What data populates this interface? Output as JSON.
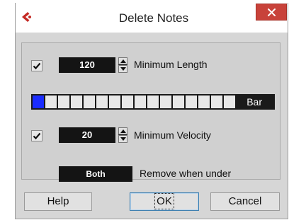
{
  "window": {
    "title": "Delete Notes",
    "app_icon": "cubase-logo-icon",
    "close_icon": "close-icon"
  },
  "min_length": {
    "enabled": true,
    "value": "120",
    "label": "Minimum Length",
    "slider_active_cells": 1,
    "slider_total_cells": 16,
    "slider_unit": "Bar"
  },
  "min_velocity": {
    "enabled": true,
    "value": "20",
    "label": "Minimum Velocity"
  },
  "remove": {
    "mode_value": "Both",
    "label": "Remove when under"
  },
  "buttons": {
    "help": "Help",
    "ok": "OK",
    "cancel": "Cancel"
  },
  "colors": {
    "close_button": "#c8423a",
    "slider_active": "#1a2cff",
    "field_background": "#141414",
    "dialog_background": "#d6d6d6"
  }
}
